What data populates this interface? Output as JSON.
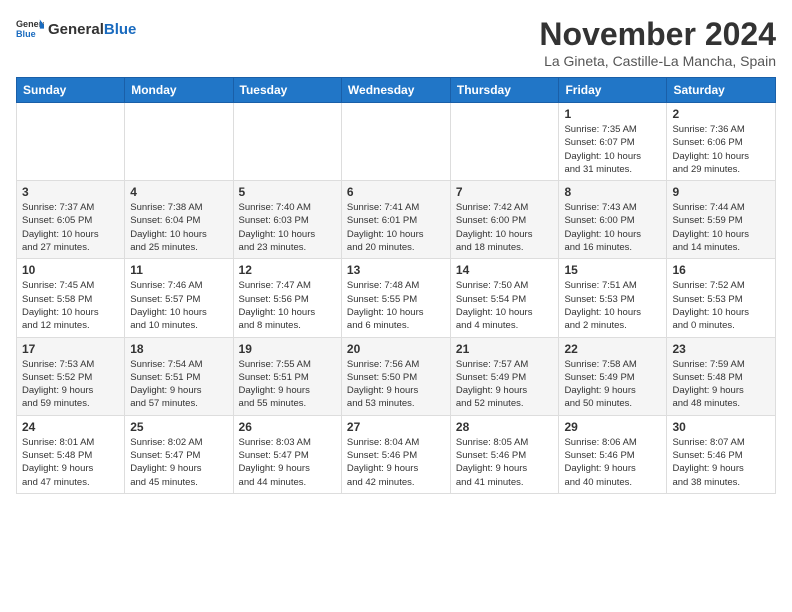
{
  "header": {
    "logo_general": "General",
    "logo_blue": "Blue",
    "month": "November 2024",
    "location": "La Gineta, Castille-La Mancha, Spain"
  },
  "weekdays": [
    "Sunday",
    "Monday",
    "Tuesday",
    "Wednesday",
    "Thursday",
    "Friday",
    "Saturday"
  ],
  "weeks": [
    {
      "row_class": "row-light",
      "days": [
        {
          "num": "",
          "info": ""
        },
        {
          "num": "",
          "info": ""
        },
        {
          "num": "",
          "info": ""
        },
        {
          "num": "",
          "info": ""
        },
        {
          "num": "",
          "info": ""
        },
        {
          "num": "1",
          "info": "Sunrise: 7:35 AM\nSunset: 6:07 PM\nDaylight: 10 hours\nand 31 minutes."
        },
        {
          "num": "2",
          "info": "Sunrise: 7:36 AM\nSunset: 6:06 PM\nDaylight: 10 hours\nand 29 minutes."
        }
      ]
    },
    {
      "row_class": "row-dark",
      "days": [
        {
          "num": "3",
          "info": "Sunrise: 7:37 AM\nSunset: 6:05 PM\nDaylight: 10 hours\nand 27 minutes."
        },
        {
          "num": "4",
          "info": "Sunrise: 7:38 AM\nSunset: 6:04 PM\nDaylight: 10 hours\nand 25 minutes."
        },
        {
          "num": "5",
          "info": "Sunrise: 7:40 AM\nSunset: 6:03 PM\nDaylight: 10 hours\nand 23 minutes."
        },
        {
          "num": "6",
          "info": "Sunrise: 7:41 AM\nSunset: 6:01 PM\nDaylight: 10 hours\nand 20 minutes."
        },
        {
          "num": "7",
          "info": "Sunrise: 7:42 AM\nSunset: 6:00 PM\nDaylight: 10 hours\nand 18 minutes."
        },
        {
          "num": "8",
          "info": "Sunrise: 7:43 AM\nSunset: 6:00 PM\nDaylight: 10 hours\nand 16 minutes."
        },
        {
          "num": "9",
          "info": "Sunrise: 7:44 AM\nSunset: 5:59 PM\nDaylight: 10 hours\nand 14 minutes."
        }
      ]
    },
    {
      "row_class": "row-light",
      "days": [
        {
          "num": "10",
          "info": "Sunrise: 7:45 AM\nSunset: 5:58 PM\nDaylight: 10 hours\nand 12 minutes."
        },
        {
          "num": "11",
          "info": "Sunrise: 7:46 AM\nSunset: 5:57 PM\nDaylight: 10 hours\nand 10 minutes."
        },
        {
          "num": "12",
          "info": "Sunrise: 7:47 AM\nSunset: 5:56 PM\nDaylight: 10 hours\nand 8 minutes."
        },
        {
          "num": "13",
          "info": "Sunrise: 7:48 AM\nSunset: 5:55 PM\nDaylight: 10 hours\nand 6 minutes."
        },
        {
          "num": "14",
          "info": "Sunrise: 7:50 AM\nSunset: 5:54 PM\nDaylight: 10 hours\nand 4 minutes."
        },
        {
          "num": "15",
          "info": "Sunrise: 7:51 AM\nSunset: 5:53 PM\nDaylight: 10 hours\nand 2 minutes."
        },
        {
          "num": "16",
          "info": "Sunrise: 7:52 AM\nSunset: 5:53 PM\nDaylight: 10 hours\nand 0 minutes."
        }
      ]
    },
    {
      "row_class": "row-dark",
      "days": [
        {
          "num": "17",
          "info": "Sunrise: 7:53 AM\nSunset: 5:52 PM\nDaylight: 9 hours\nand 59 minutes."
        },
        {
          "num": "18",
          "info": "Sunrise: 7:54 AM\nSunset: 5:51 PM\nDaylight: 9 hours\nand 57 minutes."
        },
        {
          "num": "19",
          "info": "Sunrise: 7:55 AM\nSunset: 5:51 PM\nDaylight: 9 hours\nand 55 minutes."
        },
        {
          "num": "20",
          "info": "Sunrise: 7:56 AM\nSunset: 5:50 PM\nDaylight: 9 hours\nand 53 minutes."
        },
        {
          "num": "21",
          "info": "Sunrise: 7:57 AM\nSunset: 5:49 PM\nDaylight: 9 hours\nand 52 minutes."
        },
        {
          "num": "22",
          "info": "Sunrise: 7:58 AM\nSunset: 5:49 PM\nDaylight: 9 hours\nand 50 minutes."
        },
        {
          "num": "23",
          "info": "Sunrise: 7:59 AM\nSunset: 5:48 PM\nDaylight: 9 hours\nand 48 minutes."
        }
      ]
    },
    {
      "row_class": "row-light",
      "days": [
        {
          "num": "24",
          "info": "Sunrise: 8:01 AM\nSunset: 5:48 PM\nDaylight: 9 hours\nand 47 minutes."
        },
        {
          "num": "25",
          "info": "Sunrise: 8:02 AM\nSunset: 5:47 PM\nDaylight: 9 hours\nand 45 minutes."
        },
        {
          "num": "26",
          "info": "Sunrise: 8:03 AM\nSunset: 5:47 PM\nDaylight: 9 hours\nand 44 minutes."
        },
        {
          "num": "27",
          "info": "Sunrise: 8:04 AM\nSunset: 5:46 PM\nDaylight: 9 hours\nand 42 minutes."
        },
        {
          "num": "28",
          "info": "Sunrise: 8:05 AM\nSunset: 5:46 PM\nDaylight: 9 hours\nand 41 minutes."
        },
        {
          "num": "29",
          "info": "Sunrise: 8:06 AM\nSunset: 5:46 PM\nDaylight: 9 hours\nand 40 minutes."
        },
        {
          "num": "30",
          "info": "Sunrise: 8:07 AM\nSunset: 5:46 PM\nDaylight: 9 hours\nand 38 minutes."
        }
      ]
    }
  ]
}
